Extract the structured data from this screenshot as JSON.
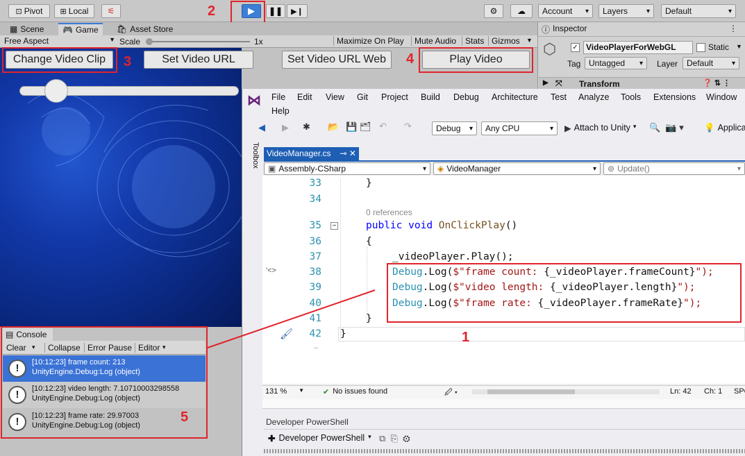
{
  "toolbar": {
    "pivot": "Pivot",
    "local": "Local",
    "account": "Account",
    "layers": "Layers",
    "layout": "Default"
  },
  "tabs": {
    "scene": "Scene",
    "game": "Game",
    "asset_store": "Asset Store",
    "inspector": "Inspector"
  },
  "gamebar": {
    "aspect": "Free Aspect",
    "scale_label": "Scale",
    "scale_value": "1x",
    "maximize": "Maximize On Play",
    "mute": "Mute Audio",
    "stats": "Stats",
    "gizmos": "Gizmos"
  },
  "game_buttons": {
    "change_clip": "Change Video Clip",
    "set_url": "Set Video URL",
    "set_url_web": "Set Video URL Web",
    "play_video": "Play Video"
  },
  "inspector": {
    "object_name": "VideoPlayerForWebGL",
    "static_label": "Static",
    "tag_label": "Tag",
    "tag_value": "Untagged",
    "layer_label": "Layer",
    "layer_value": "Default",
    "transform": "Transform"
  },
  "vs": {
    "menu": [
      "File",
      "Edit",
      "View",
      "Git",
      "Project",
      "Build",
      "Debug",
      "Architecture",
      "Test",
      "Analyze",
      "Tools",
      "Extensions",
      "Window",
      "Help"
    ],
    "config": "Debug",
    "platform": "Any CPU",
    "attach": "Attach to Unity",
    "applica": "Applica",
    "toolbox": "Toolbox",
    "file_tab": "VideoManager.cs",
    "nav_project": "Assembly-CSharp",
    "nav_class": "VideoManager",
    "nav_member": "Update()",
    "line_numbers": [
      "33",
      "34",
      "35",
      "36",
      "37",
      "38",
      "39",
      "40",
      "41",
      "42"
    ],
    "references": "0 references",
    "code": {
      "l33": "}",
      "l35_kw1": "public",
      "l35_kw2": "void",
      "l35_name": "OnClickPlay",
      "l35_rest": "()",
      "l36": "{",
      "l37": "_videoPlayer.Play();",
      "l38_a": "Debug",
      "l38_b": ".Log(",
      "l38_c": "$\"frame count: ",
      "l38_d": "{_videoPlayer.frameCount}",
      "l38_e": "\");",
      "l39_a": "Debug",
      "l39_b": ".Log(",
      "l39_c": "$\"video length: ",
      "l39_d": "{_videoPlayer.length}",
      "l39_e": "\");",
      "l40_a": "Debug",
      "l40_b": ".Log(",
      "l40_c": "$\"frame rate: ",
      "l40_d": "{_videoPlayer.frameRate}",
      "l40_e": "\");",
      "l41": "}",
      "l42": "}"
    },
    "status": {
      "zoom": "131 %",
      "issues": "No issues found",
      "ln": "Ln: 42",
      "ch": "Ch: 1",
      "spc": "SPC"
    },
    "powershell_title": "Developer PowerShell",
    "powershell_button": "Developer PowerShell"
  },
  "console": {
    "title": "Console",
    "clear": "Clear",
    "collapse": "Collapse",
    "error_pause": "Error Pause",
    "editor": "Editor",
    "logs": [
      {
        "line1": "[10:12:23] frame count: 213",
        "line2": "UnityEngine.Debug:Log (object)"
      },
      {
        "line1": "[10:12:23] video length: 7.10710003298558",
        "line2": "UnityEngine.Debug:Log (object)"
      },
      {
        "line1": "[10:12:23] frame rate: 29.97003",
        "line2": "UnityEngine.Debug:Log (object)"
      }
    ]
  },
  "annotations": {
    "n1": "1",
    "n2": "2",
    "n3": "3",
    "n4": "4",
    "n5": "5"
  },
  "colors": {
    "accent_red": "#e0242b",
    "play_blue": "#3d7fd6",
    "vs_purple": "#68217a",
    "game_bg": "#0a2a8a"
  }
}
